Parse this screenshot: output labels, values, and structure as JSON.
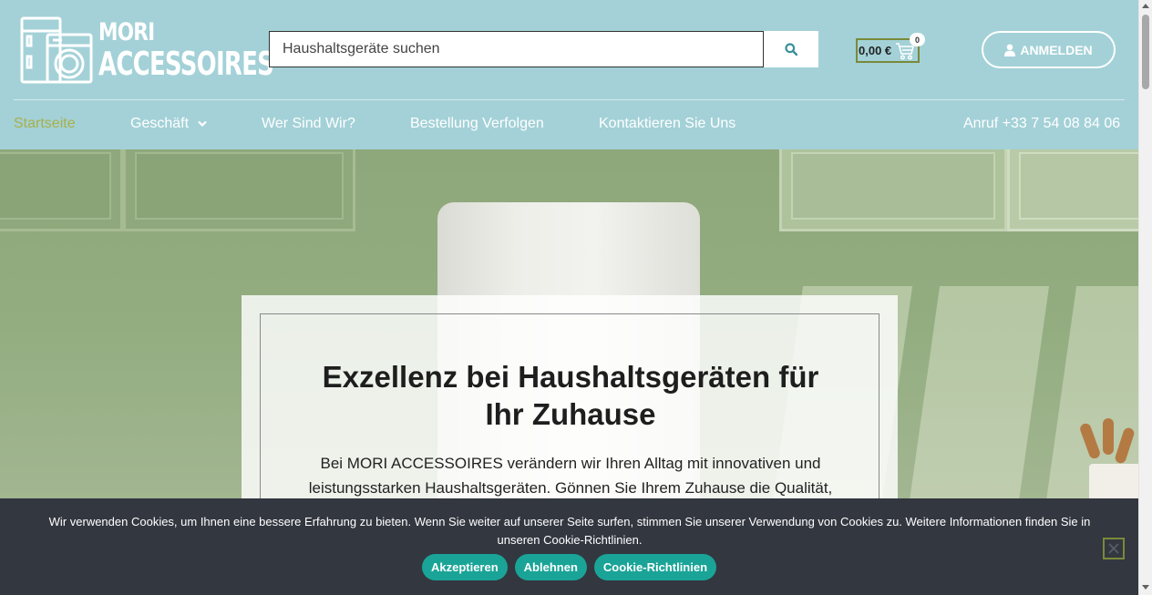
{
  "header": {
    "logo": {
      "line1": "MORI",
      "line2": "ACCESSOIRES"
    },
    "search": {
      "placeholder": "Haushaltsgeräte suchen",
      "button_icon": "search-icon"
    },
    "cart": {
      "price": "0,00 €",
      "count": "0",
      "icon": "cart-icon"
    },
    "login": {
      "label": "ANMELDEN",
      "icon": "user-icon"
    },
    "colors": {
      "background": "#a3d1d7",
      "active_nav": "#a8b04a"
    }
  },
  "nav": {
    "items": [
      {
        "label": "Startseite",
        "active": true
      },
      {
        "label": "Geschäft",
        "has_dropdown": true
      },
      {
        "label": "Wer Sind Wir?"
      },
      {
        "label": "Bestellung Verfolgen"
      },
      {
        "label": "Kontaktieren Sie Uns"
      }
    ],
    "phone": "Anruf +33 7 54 08 84 06"
  },
  "hero": {
    "title_line1": "Exzellenz bei Haushaltsgeräten für",
    "title_line2": "Ihr Zuhause",
    "text": "Bei MORI ACCESSOIRES verändern wir Ihren Alltag mit innovativen und leistungsstarken Haushaltsgeräten. Gönnen Sie Ihrem Zuhause die Qualität,"
  },
  "cookie": {
    "text": "Wir verwenden Cookies, um Ihnen eine bessere Erfahrung zu bieten. Wenn Sie weiter auf unserer Seite surfen, stimmen Sie unserer Verwendung von Cookies zu. Weitere Informationen finden Sie in unseren Cookie-Richtlinien.",
    "accept": "Akzeptieren",
    "decline": "Ablehnen",
    "policy": "Cookie-Richtlinien",
    "button_color": "#1aa497",
    "background": "#333740"
  }
}
